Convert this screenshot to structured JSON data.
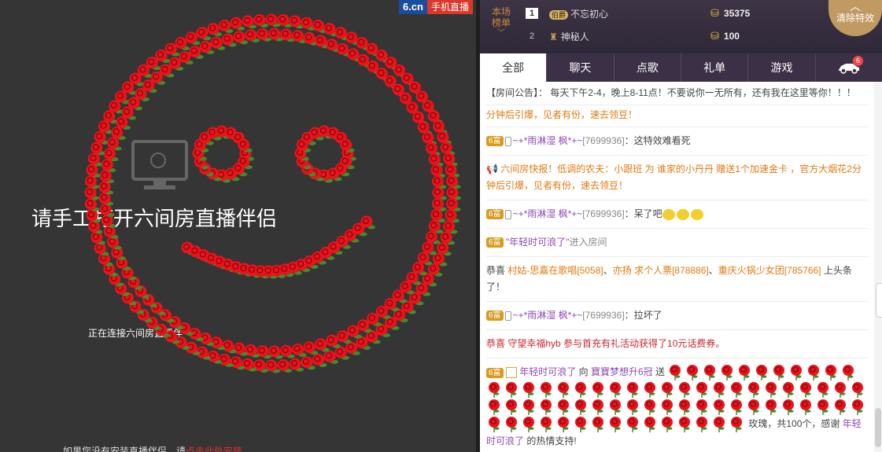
{
  "logo": {
    "brand": "6.cn",
    "mobile": "手机直播"
  },
  "video": {
    "title": "请手工打开六间房直播伴侣",
    "connecting": "正在连接六间房直播伴",
    "install_prefix": "如果您没有安装直播伴侣，请",
    "install_link": "点击此处安装"
  },
  "rank": {
    "label_top": "本场",
    "label_bottom": "榜单",
    "rows": [
      {
        "num": "1",
        "level": "伯爵",
        "name": "不忘初心",
        "amount": "35375"
      },
      {
        "num": "2",
        "name": "神秘人",
        "amount": "100"
      }
    ]
  },
  "clear_effects": "清除特效",
  "tabs": [
    {
      "label": "全部"
    },
    {
      "label": "聊天"
    },
    {
      "label": "点歌"
    },
    {
      "label": "礼单"
    },
    {
      "label": "游戏"
    },
    {
      "label": "",
      "badge": "6"
    }
  ],
  "messages": {
    "announce": "【房间公告】： 每天下午2-4，晚上8-11点！不要说你一无所有，还有我在这里等你！！！",
    "partial": "分钟后引爆，见者有份，速去领豆！",
    "m1": {
      "badge": "6富",
      "nick": "~+*雨淋湿 枫*+~",
      "uid": "[7699936]",
      "text": "：这特效难看死"
    },
    "flash": "六间房快报！低调的农夫：小跟班 为 谁家的小丹丹 赠送1个加速金卡 ，官方大烟花2分钟后引爆，见者有份，速去领豆！",
    "m2": {
      "badge": "6富",
      "nick": "~+*雨淋湿 枫*+~",
      "uid": "[7699936]",
      "text": "：呆了吧"
    },
    "enter": {
      "badge": "6富",
      "nick": "\"年轻时可浪了\"",
      "text": "进入房间"
    },
    "congrats": {
      "prefix": "恭喜 ",
      "a": "村姑-思嘉在歌唱[5058]",
      "sep1": "、",
      "b": "亦扬 求个人票[878886]",
      "sep2": "、",
      "c": "重庆火锅少女团[785766]",
      "suffix": " 上头条了！"
    },
    "m3": {
      "badge": "6富",
      "nick": "~+*雨淋湿 枫*+~",
      "uid": "[7699936]",
      "text": "：拉坏了"
    },
    "voucher": "恭喜 守望幸福hyb 参与首充有礼活动获得了10元话费券。",
    "gift": {
      "badge": "6富",
      "sender": "年轻时可浪了",
      "to": "向",
      "receiver": "寶寶梦想升6冠",
      "send": "送",
      "tail_a": "玫瑰，共100个，感谢",
      "tail_name": "年轻时可浪了",
      "tail_b": "的热情支持!"
    }
  },
  "colors": {
    "accent": "#c09a62",
    "rose": "#e8141c",
    "leaf": "#3e8f2a",
    "tab_bg": "#3b3046"
  }
}
